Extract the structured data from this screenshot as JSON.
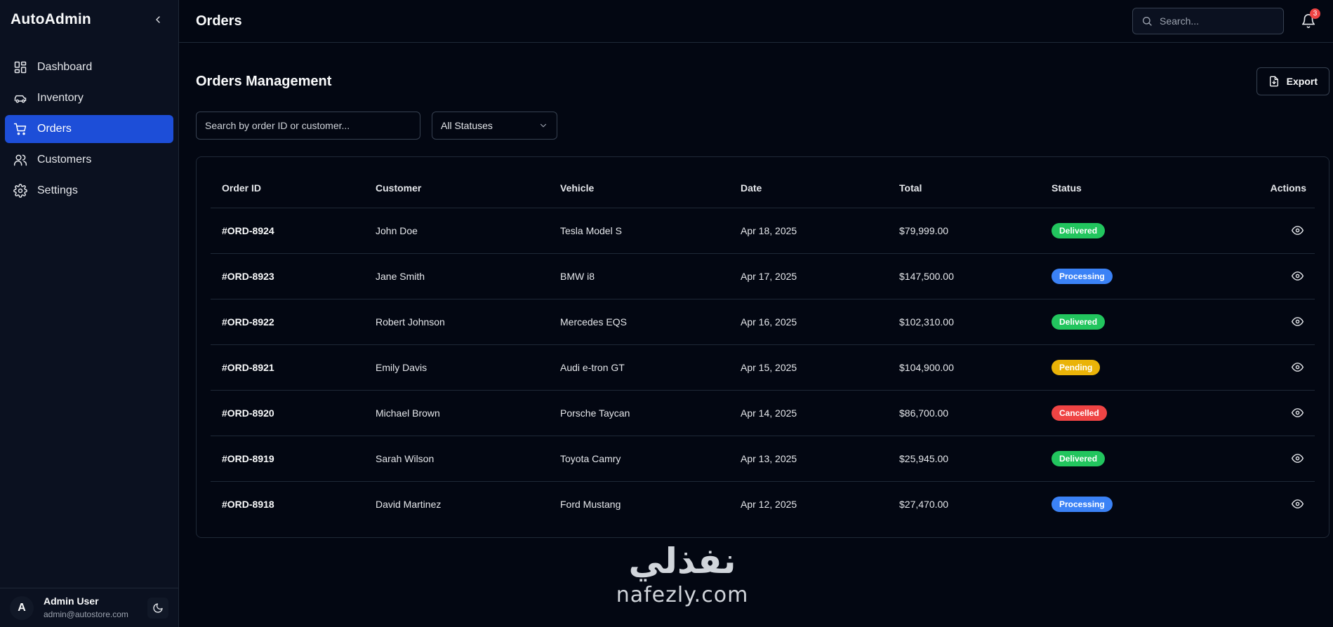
{
  "app": {
    "brand": "AutoAdmin"
  },
  "sidebar": {
    "items": [
      {
        "label": "Dashboard",
        "icon": "grid-icon",
        "active": false
      },
      {
        "label": "Inventory",
        "icon": "car-icon",
        "active": false
      },
      {
        "label": "Orders",
        "icon": "cart-icon",
        "active": true
      },
      {
        "label": "Customers",
        "icon": "users-icon",
        "active": false
      },
      {
        "label": "Settings",
        "icon": "gear-icon",
        "active": false
      }
    ],
    "user": {
      "initial": "A",
      "name": "Admin User",
      "email": "admin@autostore.com"
    }
  },
  "header": {
    "title": "Orders",
    "search_placeholder": "Search...",
    "notification_count": "3"
  },
  "page": {
    "heading": "Orders Management",
    "export_label": "Export",
    "order_search_placeholder": "Search by order ID or customer...",
    "status_filter": "All Statuses"
  },
  "table": {
    "headers": [
      "Order ID",
      "Customer",
      "Vehicle",
      "Date",
      "Total",
      "Status",
      "Actions"
    ],
    "rows": [
      {
        "id": "#ORD-8924",
        "customer": "John Doe",
        "vehicle": "Tesla Model S",
        "date": "Apr 18, 2025",
        "total": "$79,999.00",
        "status": "Delivered"
      },
      {
        "id": "#ORD-8923",
        "customer": "Jane Smith",
        "vehicle": "BMW i8",
        "date": "Apr 17, 2025",
        "total": "$147,500.00",
        "status": "Processing"
      },
      {
        "id": "#ORD-8922",
        "customer": "Robert Johnson",
        "vehicle": "Mercedes EQS",
        "date": "Apr 16, 2025",
        "total": "$102,310.00",
        "status": "Delivered"
      },
      {
        "id": "#ORD-8921",
        "customer": "Emily Davis",
        "vehicle": "Audi e-tron GT",
        "date": "Apr 15, 2025",
        "total": "$104,900.00",
        "status": "Pending"
      },
      {
        "id": "#ORD-8920",
        "customer": "Michael Brown",
        "vehicle": "Porsche Taycan",
        "date": "Apr 14, 2025",
        "total": "$86,700.00",
        "status": "Cancelled"
      },
      {
        "id": "#ORD-8919",
        "customer": "Sarah Wilson",
        "vehicle": "Toyota Camry",
        "date": "Apr 13, 2025",
        "total": "$25,945.00",
        "status": "Delivered"
      },
      {
        "id": "#ORD-8918",
        "customer": "David Martinez",
        "vehicle": "Ford Mustang",
        "date": "Apr 12, 2025",
        "total": "$27,470.00",
        "status": "Processing"
      }
    ]
  },
  "status_colors": {
    "Delivered": "#22c55e",
    "Processing": "#3b82f6",
    "Pending": "#eab308",
    "Cancelled": "#ef4444"
  },
  "watermark": {
    "logo_text": "نفذلي",
    "url": "nafezly.com"
  }
}
